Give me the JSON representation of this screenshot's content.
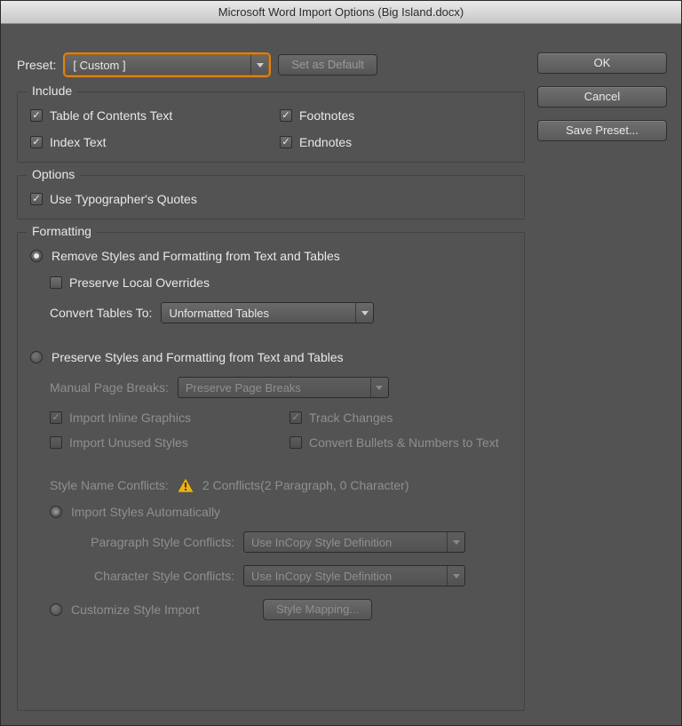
{
  "title": "Microsoft Word Import Options (Big Island.docx)",
  "side": {
    "ok": "OK",
    "cancel": "Cancel",
    "save_preset": "Save Preset..."
  },
  "preset": {
    "label": "Preset:",
    "value": "[ Custom ]",
    "set_default": "Set as Default"
  },
  "include": {
    "legend": "Include",
    "toc": "Table of Contents Text",
    "footnotes": "Footnotes",
    "index": "Index Text",
    "endnotes": "Endnotes"
  },
  "options": {
    "legend": "Options",
    "typographer": "Use Typographer's Quotes"
  },
  "formatting": {
    "legend": "Formatting",
    "remove": "Remove Styles and Formatting from Text and Tables",
    "preserve_local": "Preserve Local Overrides",
    "convert_tables_label": "Convert Tables To:",
    "convert_tables_value": "Unformatted Tables",
    "preserve": "Preserve Styles and Formatting from Text and Tables",
    "manual_breaks_label": "Manual Page Breaks:",
    "manual_breaks_value": "Preserve Page Breaks",
    "import_inline": "Import Inline Graphics",
    "track_changes": "Track Changes",
    "import_unused": "Import Unused Styles",
    "convert_bullets": "Convert Bullets & Numbers to Text",
    "conflicts_label": "Style Name Conflicts:",
    "conflicts_text": "2 Conflicts(2 Paragraph, 0 Character)",
    "import_auto": "Import Styles Automatically",
    "para_conflicts_label": "Paragraph Style Conflicts:",
    "para_conflicts_value": "Use InCopy Style Definition",
    "char_conflicts_label": "Character Style Conflicts:",
    "char_conflicts_value": "Use InCopy Style Definition",
    "customize": "Customize Style Import",
    "style_mapping": "Style Mapping..."
  }
}
